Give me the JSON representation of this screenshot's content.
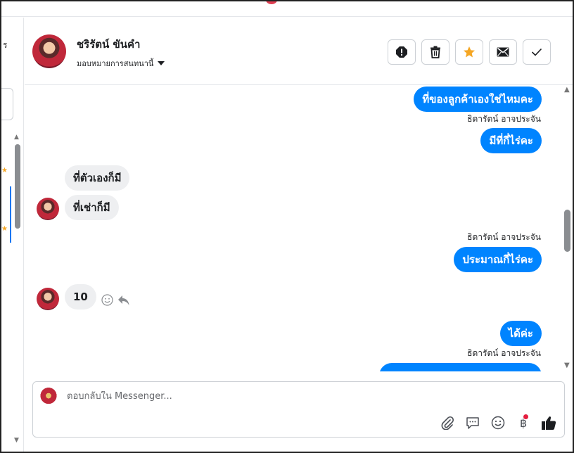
{
  "header": {
    "contact_name": "ชริรัตน์ ขันคำ",
    "assign_label": "มอบหมายการสนทนานี้",
    "actions": [
      "spam-button",
      "delete-button",
      "star-button",
      "mark-unread-button",
      "done-button"
    ]
  },
  "left_panel": {
    "cut_text": "ร"
  },
  "chat": {
    "messages": [
      {
        "direction": "out",
        "text": "ที่ของลูกค้าเองใช่ไหมคะ"
      },
      {
        "direction": "out",
        "sender": "ธิดารัตน์ อาจประจัน",
        "text": "มีที่กี่ไร่คะ"
      },
      {
        "direction": "in",
        "text": "ที่ตัวเองก็มี"
      },
      {
        "direction": "in",
        "text": "ที่เช่าก็มี"
      },
      {
        "direction": "out",
        "sender": "ธิดารัตน์ อาจประจัน",
        "text": "ประมาณกี่ไร่คะ"
      },
      {
        "direction": "in",
        "text": "10"
      },
      {
        "direction": "out",
        "text": "ได้ค่ะ"
      },
      {
        "direction": "out",
        "sender": "ธิดารัตน์ อาจประจัน",
        "text": ""
      }
    ]
  },
  "composer": {
    "placeholder": "ตอบกลับใน Messenger...",
    "tools": [
      "attach-icon",
      "saved-reply-icon",
      "emoji-icon",
      "baht-icon",
      "like-icon"
    ]
  },
  "colors": {
    "outgoing_bubble": "#0084ff",
    "incoming_bubble": "#eeeff1",
    "star": "#f5a623",
    "notification_dot": "#e41e3f"
  }
}
